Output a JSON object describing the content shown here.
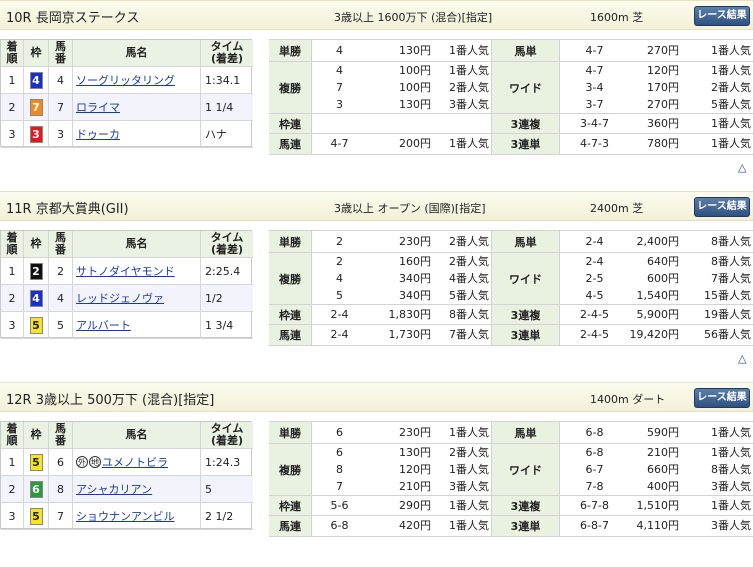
{
  "races": [
    {
      "title": "10R 長岡京ステークス",
      "conditions": "3歳以上 1600万下 (混合)[指定]",
      "distance": "1600m  芝",
      "result_button": "レース結果",
      "headers": {
        "rank": "着\n順",
        "waku": "枠",
        "uma": "馬\n番",
        "name": "馬名",
        "time": "タイム\n(着差)"
      },
      "finishers": [
        {
          "rank": "1",
          "waku": "4",
          "waku_color": "#1a2fd0",
          "waku_text": "#ffffff",
          "uma": "4",
          "name": "ソーグリッタリング",
          "time": "1:34.1"
        },
        {
          "rank": "2",
          "waku": "7",
          "waku_color": "#f08a1c",
          "waku_text": "#ffffff",
          "uma": "7",
          "name": "ロライマ",
          "time": "1 1/4"
        },
        {
          "rank": "3",
          "waku": "3",
          "waku_color": "#e21a1a",
          "waku_text": "#ffffff",
          "uma": "3",
          "name": "ドゥーカ",
          "time": "ハナ"
        }
      ],
      "payouts": [
        {
          "l1": "単勝",
          "c1": [
            "4"
          ],
          "p1": [
            "130円"
          ],
          "n1": [
            "1番人気"
          ],
          "l2": "馬単",
          "c2": [
            "4-7"
          ],
          "p2": [
            "270円"
          ],
          "n2": [
            "1番人気"
          ]
        },
        {
          "l1": "複勝",
          "c1": [
            "4",
            "7",
            "3"
          ],
          "p1": [
            "100円",
            "100円",
            "130円"
          ],
          "n1": [
            "1番人気",
            "2番人気",
            "3番人気"
          ],
          "l2": "ワイド",
          "c2": [
            "4-7",
            "3-4",
            "3-7"
          ],
          "p2": [
            "120円",
            "170円",
            "270円"
          ],
          "n2": [
            "1番人気",
            "2番人気",
            "5番人気"
          ]
        },
        {
          "l1": "枠連",
          "c1": [
            ""
          ],
          "p1": [
            ""
          ],
          "n1": [
            ""
          ],
          "l2": "3連複",
          "c2": [
            "3-4-7"
          ],
          "p2": [
            "360円"
          ],
          "n2": [
            "1番人気"
          ]
        },
        {
          "l1": "馬連",
          "c1": [
            "4-7"
          ],
          "p1": [
            "200円"
          ],
          "n1": [
            "1番人気"
          ],
          "l2": "3連単",
          "c2": [
            "4-7-3"
          ],
          "p2": [
            "780円"
          ],
          "n2": [
            "1番人気"
          ]
        }
      ],
      "up_symbol": "△"
    },
    {
      "title": "11R 京都大賞典(GII)",
      "conditions": "3歳以上 オープン (国際)[指定]",
      "distance": "2400m  芝",
      "result_button": "レース結果",
      "headers": {
        "rank": "着\n順",
        "waku": "枠",
        "uma": "馬\n番",
        "name": "馬名",
        "time": "タイム\n(着差)"
      },
      "finishers": [
        {
          "rank": "1",
          "waku": "2",
          "waku_color": "#111111",
          "waku_text": "#ffffff",
          "uma": "2",
          "name": "サトノダイヤモンド",
          "time": "2:25.4"
        },
        {
          "rank": "2",
          "waku": "4",
          "waku_color": "#1a2fd0",
          "waku_text": "#ffffff",
          "uma": "4",
          "name": "レッドジェノヴァ",
          "time": "1/2"
        },
        {
          "rank": "3",
          "waku": "5",
          "waku_color": "#f6e51b",
          "waku_text": "#222222",
          "uma": "5",
          "name": "アルバート",
          "time": "1 3/4"
        }
      ],
      "payouts": [
        {
          "l1": "単勝",
          "c1": [
            "2"
          ],
          "p1": [
            "230円"
          ],
          "n1": [
            "2番人気"
          ],
          "l2": "馬単",
          "c2": [
            "2-4"
          ],
          "p2": [
            "2,400円"
          ],
          "n2": [
            "8番人気"
          ]
        },
        {
          "l1": "複勝",
          "c1": [
            "2",
            "4",
            "5"
          ],
          "p1": [
            "160円",
            "340円",
            "340円"
          ],
          "n1": [
            "2番人気",
            "4番人気",
            "5番人気"
          ],
          "l2": "ワイド",
          "c2": [
            "2-4",
            "2-5",
            "4-5"
          ],
          "p2": [
            "640円",
            "600円",
            "1,540円"
          ],
          "n2": [
            "8番人気",
            "7番人気",
            "15番人気"
          ]
        },
        {
          "l1": "枠連",
          "c1": [
            "2-4"
          ],
          "p1": [
            "1,830円"
          ],
          "n1": [
            "8番人気"
          ],
          "l2": "3連複",
          "c2": [
            "2-4-5"
          ],
          "p2": [
            "5,900円"
          ],
          "n2": [
            "19番人気"
          ]
        },
        {
          "l1": "馬連",
          "c1": [
            "2-4"
          ],
          "p1": [
            "1,730円"
          ],
          "n1": [
            "7番人気"
          ],
          "l2": "3連単",
          "c2": [
            "2-4-5"
          ],
          "p2": [
            "19,420円"
          ],
          "n2": [
            "56番人気"
          ]
        }
      ],
      "up_symbol": "△"
    },
    {
      "title": "12R 3歳以上 500万下 (混合)[指定]",
      "conditions": "",
      "distance": "1400m  ダート",
      "result_button": "レース結果",
      "headers": {
        "rank": "着\n順",
        "waku": "枠",
        "uma": "馬\n番",
        "name": "馬名",
        "time": "タイム\n(着差)"
      },
      "finishers": [
        {
          "rank": "1",
          "waku": "5",
          "waku_color": "#f6e51b",
          "waku_text": "#222222",
          "uma": "6",
          "name": "ユメノトビラ",
          "badges": [
            "外",
            "地"
          ],
          "time": "1:24.3"
        },
        {
          "rank": "2",
          "waku": "6",
          "waku_color": "#2a9a3a",
          "waku_text": "#ffffff",
          "uma": "8",
          "name": "アシャカリアン",
          "time": "5"
        },
        {
          "rank": "3",
          "waku": "5",
          "waku_color": "#f6e51b",
          "waku_text": "#222222",
          "uma": "7",
          "name": "ショウナンアンビル",
          "time": "2 1/2"
        }
      ],
      "payouts": [
        {
          "l1": "単勝",
          "c1": [
            "6"
          ],
          "p1": [
            "230円"
          ],
          "n1": [
            "1番人気"
          ],
          "l2": "馬単",
          "c2": [
            "6-8"
          ],
          "p2": [
            "590円"
          ],
          "n2": [
            "1番人気"
          ]
        },
        {
          "l1": "複勝",
          "c1": [
            "6",
            "8",
            "7"
          ],
          "p1": [
            "130円",
            "120円",
            "210円"
          ],
          "n1": [
            "2番人気",
            "1番人気",
            "3番人気"
          ],
          "l2": "ワイド",
          "c2": [
            "6-8",
            "6-7",
            "7-8"
          ],
          "p2": [
            "210円",
            "660円",
            "400円"
          ],
          "n2": [
            "1番人気",
            "8番人気",
            "3番人気"
          ]
        },
        {
          "l1": "枠連",
          "c1": [
            "5-6"
          ],
          "p1": [
            "290円"
          ],
          "n1": [
            "1番人気"
          ],
          "l2": "3連複",
          "c2": [
            "6-7-8"
          ],
          "p2": [
            "1,510円"
          ],
          "n2": [
            "1番人気"
          ]
        },
        {
          "l1": "馬連",
          "c1": [
            "6-8"
          ],
          "p1": [
            "420円"
          ],
          "n1": [
            "1番人気"
          ],
          "l2": "3連単",
          "c2": [
            "6-8-7"
          ],
          "p2": [
            "4,110円"
          ],
          "n2": [
            "3番人気"
          ]
        }
      ],
      "up_symbol": ""
    }
  ]
}
